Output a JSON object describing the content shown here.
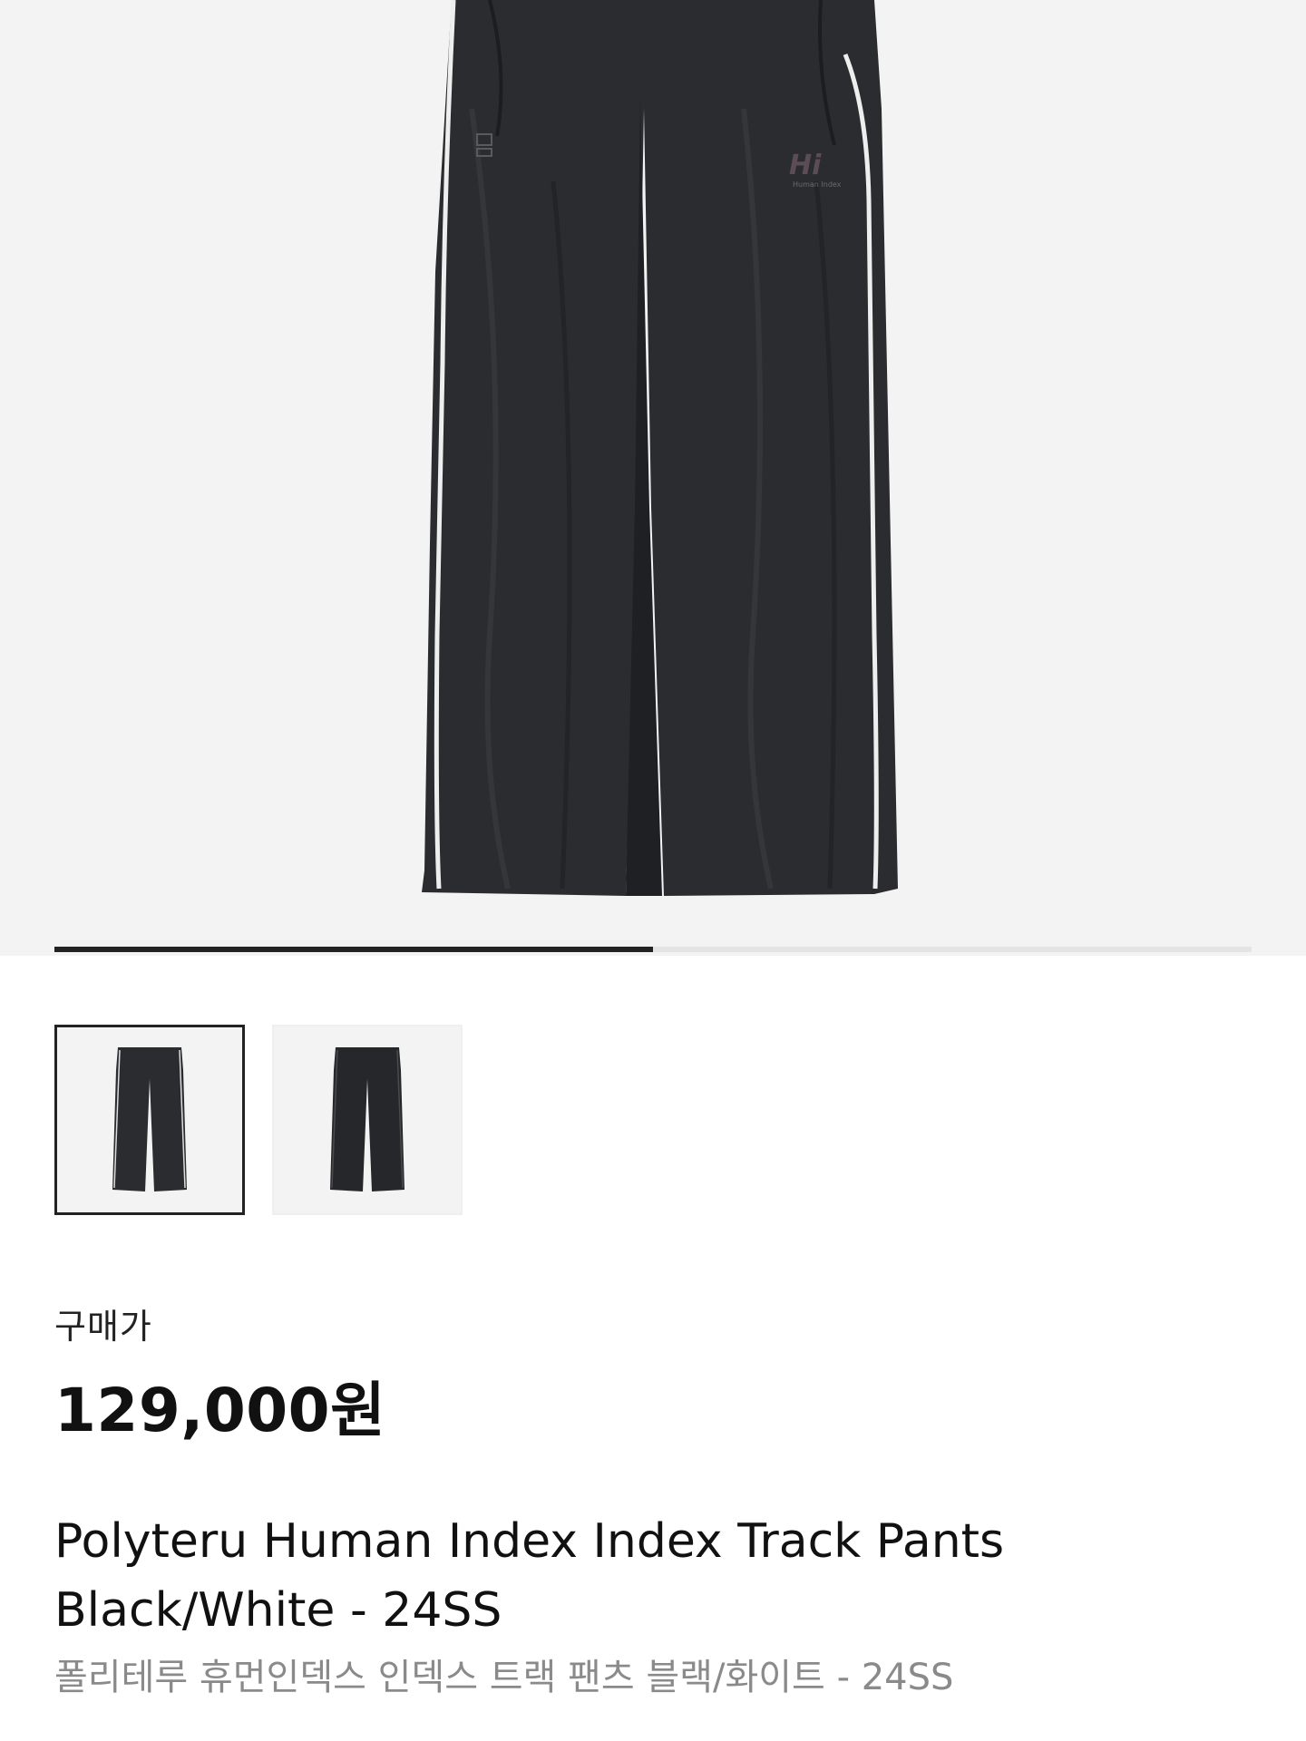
{
  "hero": {
    "image": "product-photo-black-track-pants",
    "brand_mark": "Human Index"
  },
  "carousel": {
    "total_images": 2,
    "current_index": 1,
    "progress_fraction": 0.5
  },
  "thumbnails": [
    {
      "label": "thumbnail-1",
      "active": true
    },
    {
      "label": "thumbnail-2",
      "active": false
    }
  ],
  "price_section": {
    "label": "구매가",
    "price": "129,000원"
  },
  "product": {
    "title_en": "Polyteru Human Index Index Track Pants Black/White - 24SS",
    "title_ko": "폴리테루 휴먼인덱스 인덱스 트랙 팬츠 블랙/화이트 - 24SS"
  },
  "colors": {
    "background": "#ffffff",
    "image_bg": "#f3f3f3",
    "pants": "#2b2c2f",
    "piping": "#eeeeee",
    "progress_active": "#222222",
    "progress_track": "#e4e4e4",
    "subtitle": "#8a8a8a"
  }
}
